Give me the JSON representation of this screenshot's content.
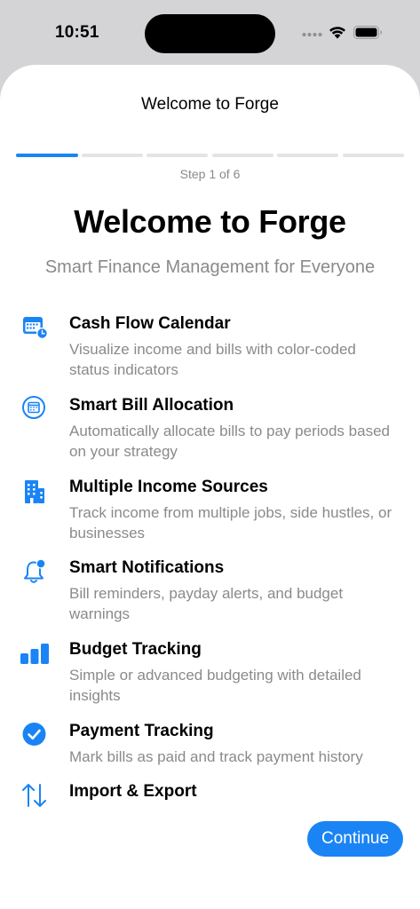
{
  "status_bar": {
    "time": "10:51",
    "icons": [
      "signal-dots-icon",
      "wifi-icon",
      "battery-icon"
    ]
  },
  "sheet": {
    "title": "Welcome to Forge",
    "progress": {
      "current_step": 1,
      "total_steps": 6
    },
    "step_label": "Step 1 of 6",
    "hero_title": "Welcome to Forge",
    "hero_subtitle": "Smart Finance Management for Everyone",
    "features": [
      {
        "icon": "calendar-clock-icon",
        "title": "Cash Flow Calendar",
        "description": "Visualize income and bills with color-coded status indicators"
      },
      {
        "icon": "calendar-circle-icon",
        "title": "Smart Bill Allocation",
        "description": "Automatically allocate bills to pay periods based on your strategy"
      },
      {
        "icon": "building-icon",
        "title": "Multiple Income Sources",
        "description": "Track income from multiple jobs, side hustles, or businesses"
      },
      {
        "icon": "bell-badge-icon",
        "title": "Smart Notifications",
        "description": "Bill reminders, payday alerts, and budget warnings"
      },
      {
        "icon": "bar-chart-icon",
        "title": "Budget Tracking",
        "description": "Simple or advanced budgeting with detailed insights"
      },
      {
        "icon": "checkmark-circle-icon",
        "title": "Payment Tracking",
        "description": "Mark bills as paid and track payment history"
      },
      {
        "icon": "arrows-up-down-icon",
        "title": "Import & Export",
        "description": ""
      }
    ],
    "continue_label": "Continue"
  },
  "colors": {
    "accent": "#1a84f5",
    "secondary_text": "#8a8a8e",
    "progress_track": "#e4e4e6",
    "background_dim": "#d4d4d6"
  }
}
